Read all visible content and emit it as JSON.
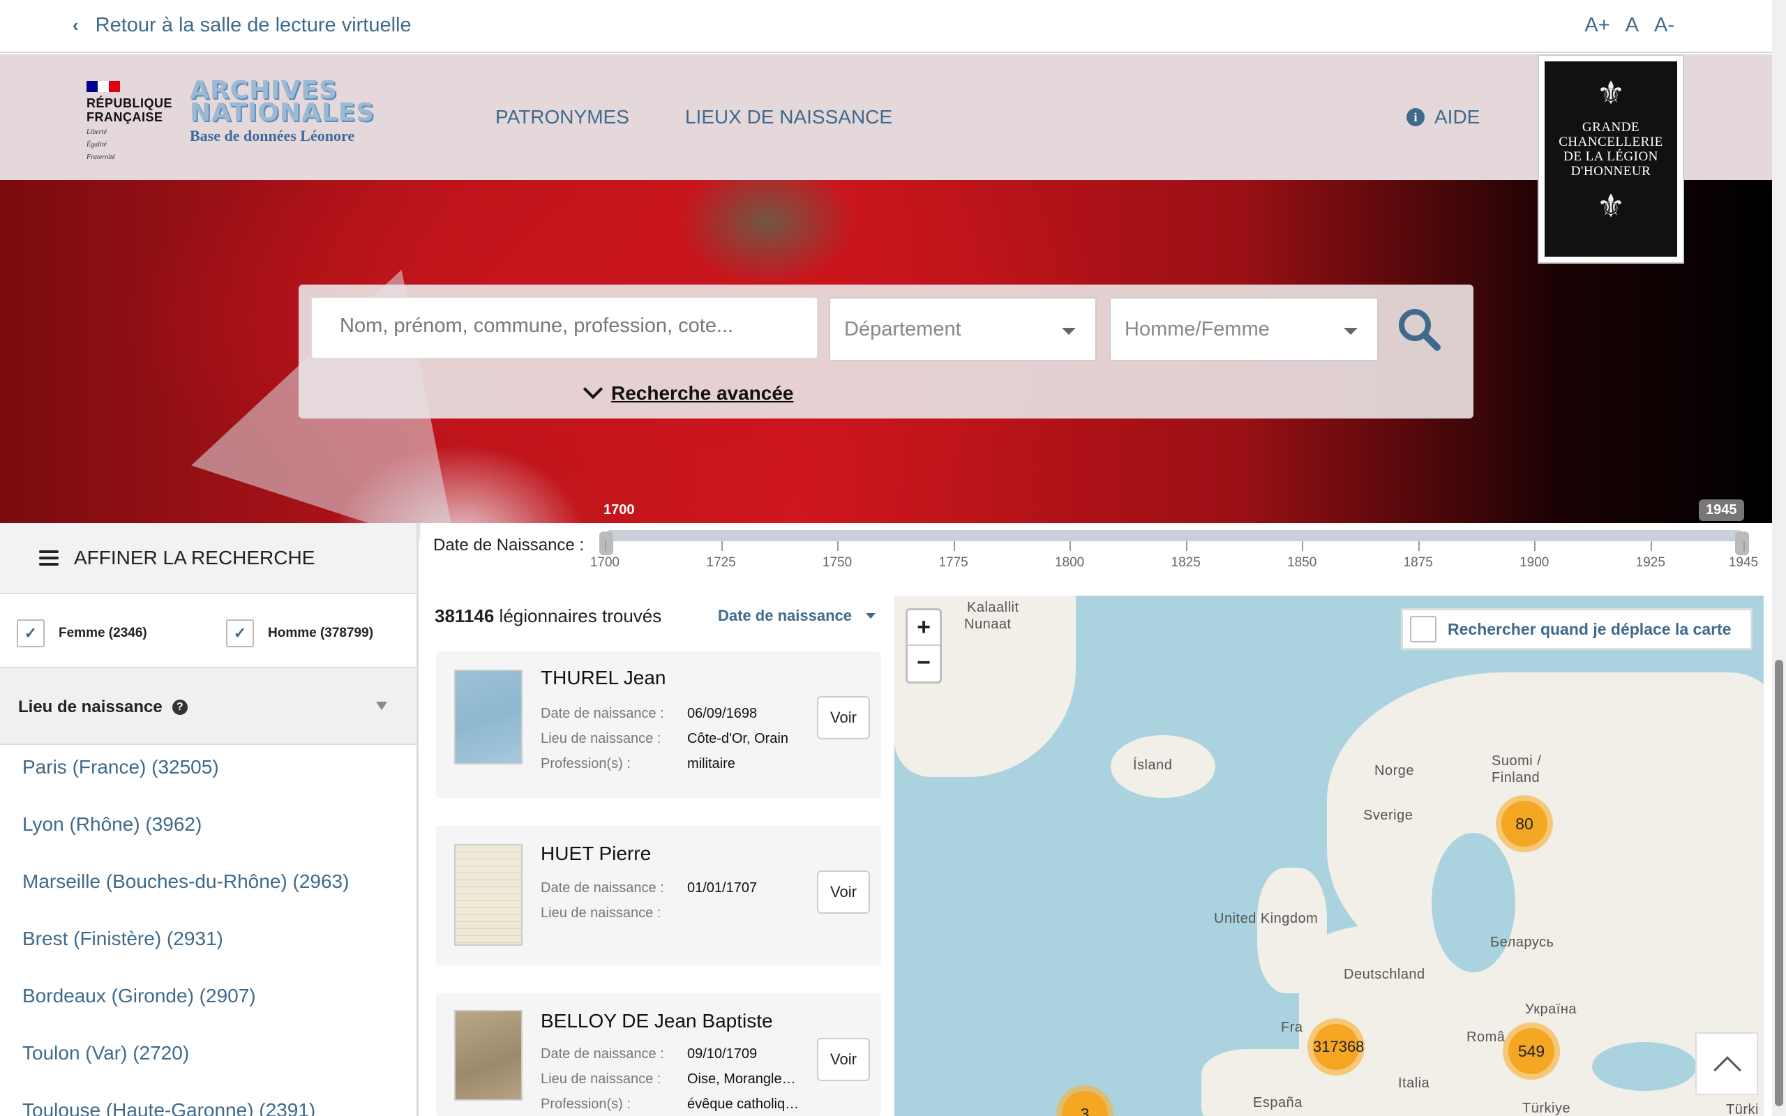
{
  "topbar": {
    "back_label": "Retour à la salle de lecture virtuelle",
    "font_sizes": [
      "A+",
      "A",
      "A-"
    ]
  },
  "header": {
    "rf_title_lines": [
      "RÉPUBLIQUE",
      "FRANÇAISE"
    ],
    "rf_motto_lines": [
      "Liberté",
      "Égalité",
      "Fraternité"
    ],
    "an_line1": "ARCHIVES",
    "an_line2": "NATIONALES",
    "an_subtitle": "Base de données Léonore",
    "nav": [
      "PATRONYMES",
      "LIEUX DE NAISSANCE"
    ],
    "help": "AIDE",
    "gc_text_lines": [
      "GRANDE",
      "CHANCELLERIE",
      "DE LA LÉGION",
      "D'HONNEUR"
    ]
  },
  "search": {
    "placeholder": "Nom, prénom, commune, profession, cote...",
    "department": "Département",
    "sex": "Homme/Femme",
    "advanced": "Recherche avancée"
  },
  "sidebar": {
    "title": "AFFINER LA RECHERCHE",
    "female": "Femme (2346)",
    "male": "Homme (378799)",
    "birthplace_title": "Lieu de naissance",
    "places": [
      "Paris (France) (32505)",
      "Lyon (Rhône) (3962)",
      "Marseille (Bouches-du-Rhône) (2963)",
      "Brest (Finistère) (2931)",
      "Bordeaux (Gironde) (2907)",
      "Toulon (Var) (2720)",
      "Toulouse (Haute-Garonne) (2391)"
    ]
  },
  "slider": {
    "label": "Date de Naissance :",
    "min": 1700,
    "max": 1945,
    "min_label": "1700",
    "max_label": "1945",
    "ticks": [
      "1700",
      "1725",
      "1750",
      "1775",
      "1800",
      "1825",
      "1850",
      "1875",
      "1900",
      "1925",
      "1945"
    ]
  },
  "results": {
    "count": "381146",
    "count_suffix": " légionnaires trouvés",
    "sort": "Date de naissance",
    "labels": {
      "birth_date": "Date de naissance :",
      "birth_place": "Lieu de naissance :",
      "profession": "Profession(s) :"
    },
    "view_label": "Voir",
    "items": [
      {
        "name": "THUREL Jean",
        "birth_date": "06/09/1698",
        "birth_place": "Côte-d'Or, Orain",
        "profession": "militaire"
      },
      {
        "name": "HUET Pierre",
        "birth_date": "01/01/1707",
        "birth_place": "",
        "profession": ""
      },
      {
        "name": "BELLOY DE Jean Baptiste",
        "birth_date": "09/10/1709",
        "birth_place": "Oise, Morangle…",
        "profession": "évêque catholiq…"
      }
    ]
  },
  "map": {
    "zoom_in": "+",
    "zoom_out": "−",
    "move_search": "Rechercher quand je déplace la carte",
    "labels": [
      "Kalaallit",
      "Nunaat",
      "Ísland",
      "Norge",
      "Sverige",
      "Suomi /",
      "Finland",
      "United Kingdom",
      "Беларусь",
      "Deutschland",
      "Україна",
      "Fra",
      "Româ",
      "Italia",
      "España",
      "Türkiye",
      "Türki"
    ],
    "clusters": [
      "80",
      "317368",
      "549",
      "3"
    ]
  }
}
